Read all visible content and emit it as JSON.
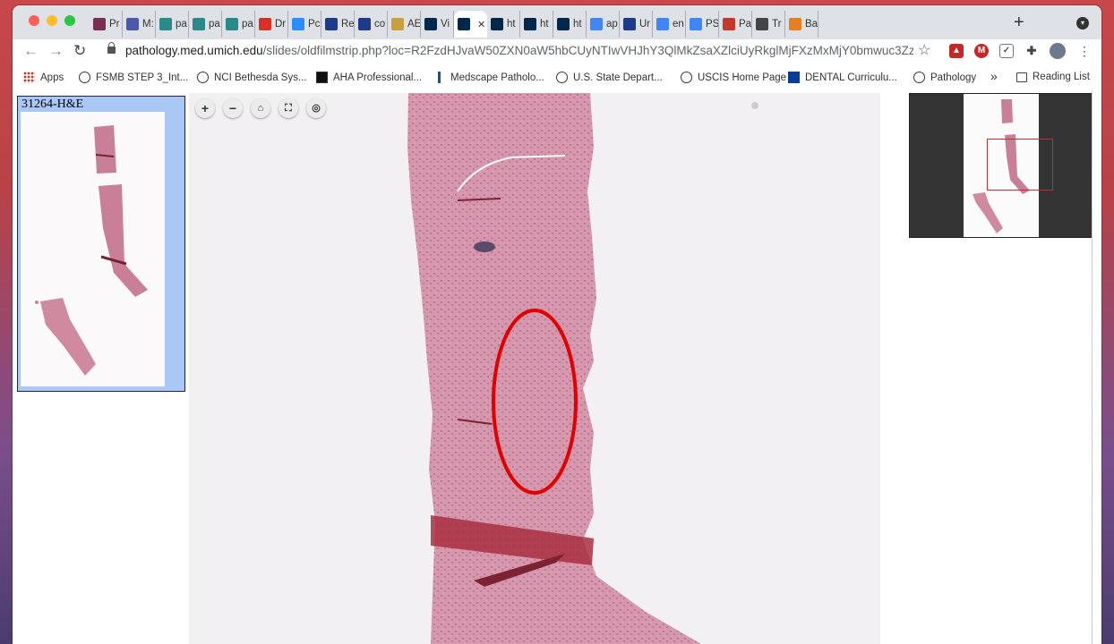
{
  "browser": {
    "tabs": [
      {
        "label": "Pr",
        "icon": "film-icon",
        "color": "#7a2e55"
      },
      {
        "label": "M:",
        "icon": "teams-icon",
        "color": "#4a5aa8"
      },
      {
        "label": "pa",
        "icon": "slide-icon",
        "color": "#2a8a8a"
      },
      {
        "label": "pa",
        "icon": "slide-icon",
        "color": "#2a8a8a"
      },
      {
        "label": "pa",
        "icon": "slide-icon",
        "color": "#2a8a8a"
      },
      {
        "label": "Dr",
        "icon": "gmail-icon",
        "color": "#d93025"
      },
      {
        "label": "Pc",
        "icon": "zoom-icon",
        "color": "#2d8cff"
      },
      {
        "label": "Re",
        "icon": "journal-icon",
        "color": "#1e3a8a"
      },
      {
        "label": "co",
        "icon": "journal-icon",
        "color": "#1e3a8a"
      },
      {
        "label": "AE",
        "icon": "book-icon",
        "color": "#c8a040"
      },
      {
        "label": "Vi",
        "icon": "umich-icon",
        "color": "#00274c"
      },
      {
        "label": "",
        "icon": "umich-icon",
        "color": "#00274c",
        "active": true
      },
      {
        "label": "ht",
        "icon": "umich-icon",
        "color": "#00274c"
      },
      {
        "label": "ht",
        "icon": "umich-icon",
        "color": "#00274c"
      },
      {
        "label": "ht",
        "icon": "umich-icon",
        "color": "#00274c"
      },
      {
        "label": "ap",
        "icon": "google-icon",
        "color": "#4285f4"
      },
      {
        "label": "Ur",
        "icon": "journal-icon",
        "color": "#1e3a8a"
      },
      {
        "label": "en",
        "icon": "google-icon",
        "color": "#4285f4"
      },
      {
        "label": "PS",
        "icon": "google-icon",
        "color": "#4285f4"
      },
      {
        "label": "Pa",
        "icon": "gear-icon",
        "color": "#c0392b"
      },
      {
        "label": "Tr",
        "icon": "globe-icon",
        "color": "#444444"
      },
      {
        "label": "Ba",
        "icon": "bookmark-icon",
        "color": "#e67e22"
      }
    ],
    "close_glyph": "✕",
    "new_tab_glyph": "+",
    "url_host": "pathology.med.umich.edu",
    "url_path": "/slides/oldfilmstrip.php?loc=R2FzdHJvaW50ZXN0aW5hbCUyNTIwVHJhY3QlMkZsaXZlciUyRkglMjFXzMxMjY0bmwuc3Zz...",
    "bookmarks": [
      {
        "label": "Apps",
        "icon": "apps-grid-icon"
      },
      {
        "label": "FSMB STEP 3_Int...",
        "icon": "globe-icon"
      },
      {
        "label": "NCI Bethesda Sys...",
        "icon": "globe-icon"
      },
      {
        "label": "AHA Professional...",
        "icon": "aha-icon"
      },
      {
        "label": "Medscape Patholo...",
        "icon": "medscape-icon"
      },
      {
        "label": "U.S. State Depart...",
        "icon": "globe-icon"
      },
      {
        "label": "USCIS Home Page",
        "icon": "seal-icon"
      },
      {
        "label": "DENTAL Curriculu...",
        "icon": "uf-icon"
      },
      {
        "label": "Pathology",
        "icon": "person-icon"
      }
    ],
    "overflow_glyph": "»",
    "reading_list": "Reading List"
  },
  "slide": {
    "label": "31264-H&E"
  }
}
